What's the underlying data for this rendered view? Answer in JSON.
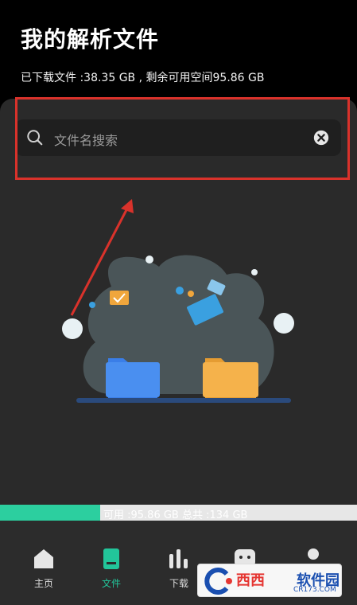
{
  "header": {
    "title": "我的解析文件",
    "storage_line": "已下载文件 :38.35 GB , 剩余可用空间95.86 GB"
  },
  "search": {
    "placeholder": "文件名搜索"
  },
  "storage_bar": {
    "text": "可用 :95.86 GB  总共 :134 GB",
    "used_fraction": 0.28,
    "used_color": "#2ccf9f"
  },
  "nav": {
    "items": [
      {
        "label": "主页",
        "icon": "home-icon"
      },
      {
        "label": "文件",
        "icon": "file-book-icon"
      },
      {
        "label": "下载",
        "icon": "download-bars-icon"
      },
      {
        "label": "",
        "icon": "chat-icon"
      },
      {
        "label": "",
        "icon": "profile-icon"
      }
    ],
    "active_color": "#22c59a"
  },
  "watermark": {
    "text_red": "西西",
    "text_blue": "软件园",
    "sub": "CR173.COM"
  },
  "colors": {
    "annotation": "#d9322b",
    "panel_bg": "#2a2a2a"
  }
}
